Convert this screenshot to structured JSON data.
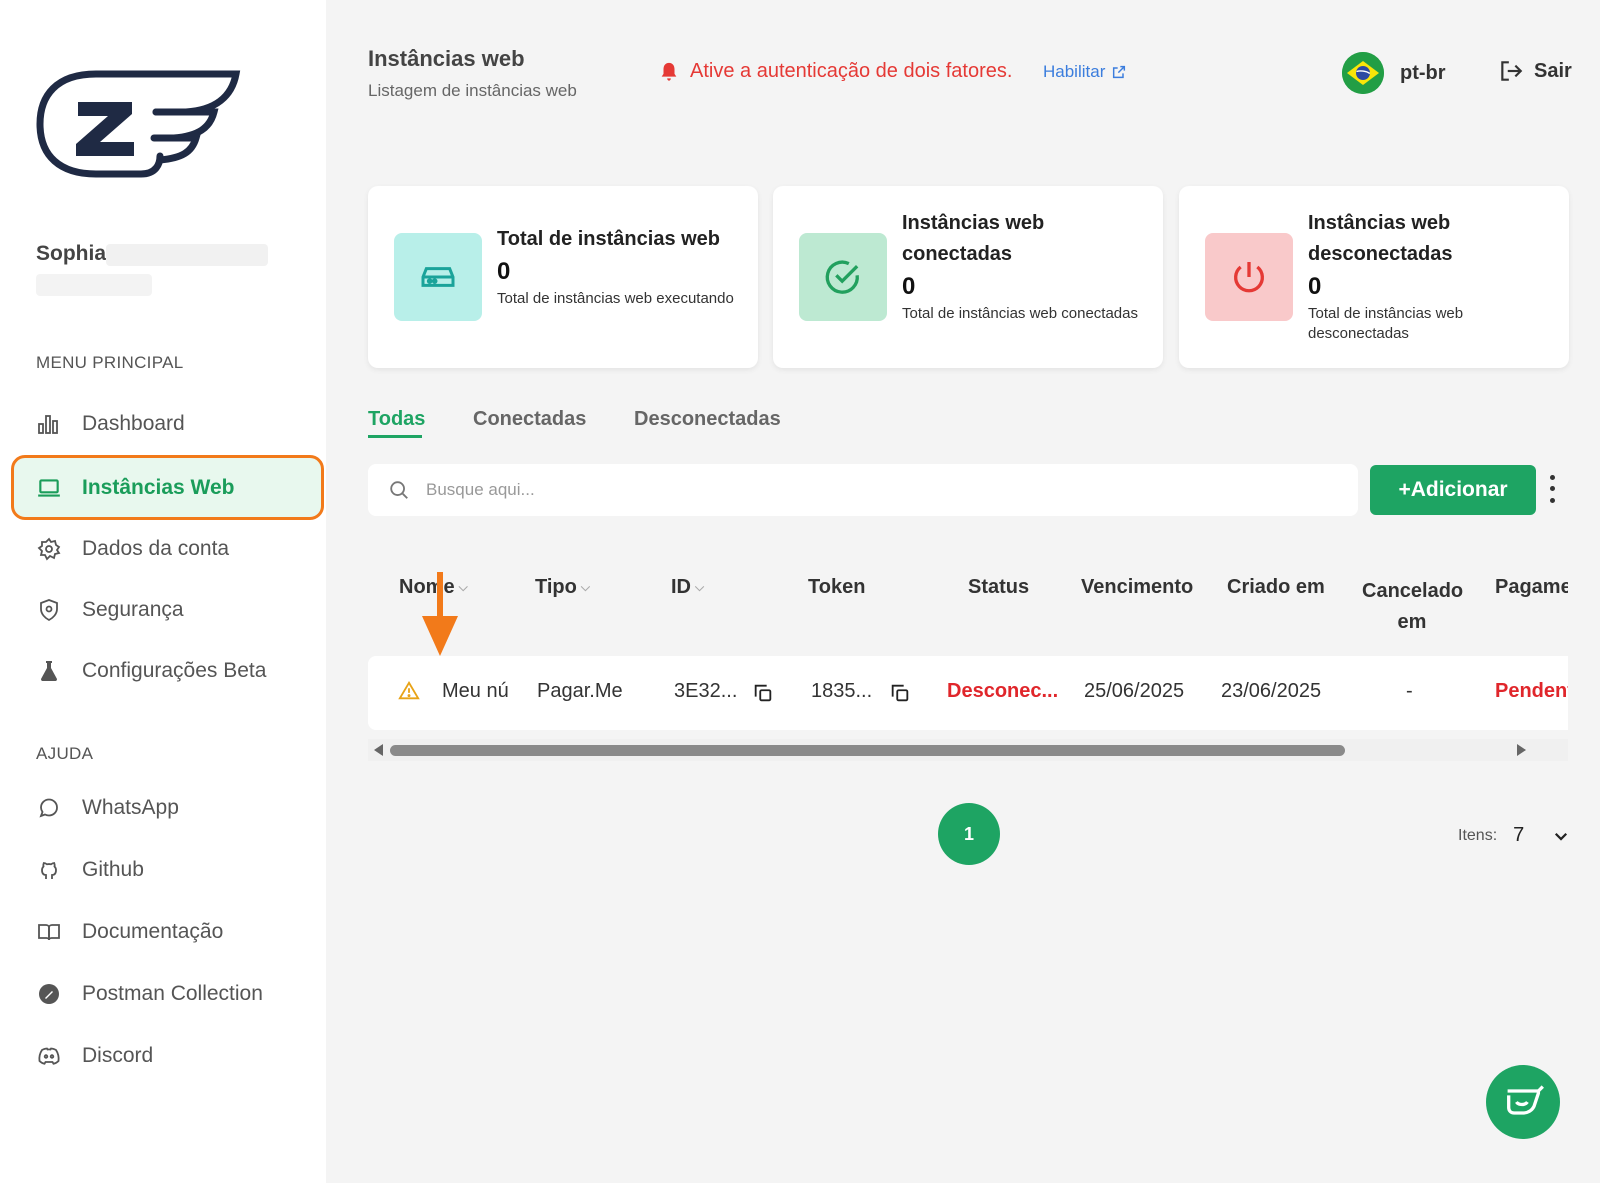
{
  "sidebar": {
    "user_name": "Sophia",
    "section_main": "MENU PRINCIPAL",
    "section_help": "AJUDA",
    "items": [
      {
        "label": "Dashboard"
      },
      {
        "label": "Instâncias Web"
      },
      {
        "label": "Dados da conta"
      },
      {
        "label": "Segurança"
      },
      {
        "label": "Configurações Beta"
      }
    ],
    "help_items": [
      {
        "label": "WhatsApp"
      },
      {
        "label": "Github"
      },
      {
        "label": "Documentação"
      },
      {
        "label": "Postman Collection"
      },
      {
        "label": "Discord"
      }
    ]
  },
  "header": {
    "title": "Instâncias web",
    "subtitle": "Listagem de instâncias web",
    "twofa_warning": "Ative a autenticação de dois fatores.",
    "enable_link": "Habilitar",
    "language": "pt-br",
    "logout": "Sair"
  },
  "cards": [
    {
      "title": "Total de instâncias web",
      "value": "0",
      "desc": "Total de instâncias web executando",
      "color": "#b8efe9"
    },
    {
      "title": "Instâncias web conectadas",
      "value": "0",
      "desc": "Total de instâncias web conectadas",
      "color": "#bde9d2"
    },
    {
      "title": "Instâncias web desconectadas",
      "value": "0",
      "desc": "Total de instâncias web desconectadas",
      "color": "#f9c9ca"
    }
  ],
  "tabs": [
    {
      "label": "Todas"
    },
    {
      "label": "Conectadas"
    },
    {
      "label": "Desconectadas"
    }
  ],
  "search": {
    "placeholder": "Busque aqui..."
  },
  "add_button": "+Adicionar",
  "table": {
    "columns": [
      "Nome",
      "Tipo",
      "ID",
      "Token",
      "Status",
      "Vencimento",
      "Criado em",
      "Cancelado em",
      "Pagame"
    ],
    "rows": [
      {
        "name": "Meu nú",
        "type": "Pagar.Me",
        "id": "3E32...",
        "token": "1835...",
        "status": "Desconec...",
        "due": "25/06/2025",
        "created": "23/06/2025",
        "cancelled": "-",
        "payment": "Pendent"
      }
    ]
  },
  "pagination": {
    "current": "1",
    "items_label": "Itens:",
    "items_value": "7"
  },
  "colors": {
    "accent": "#1ea463",
    "danger": "#e0262b",
    "highlight": "#f27a1a"
  }
}
